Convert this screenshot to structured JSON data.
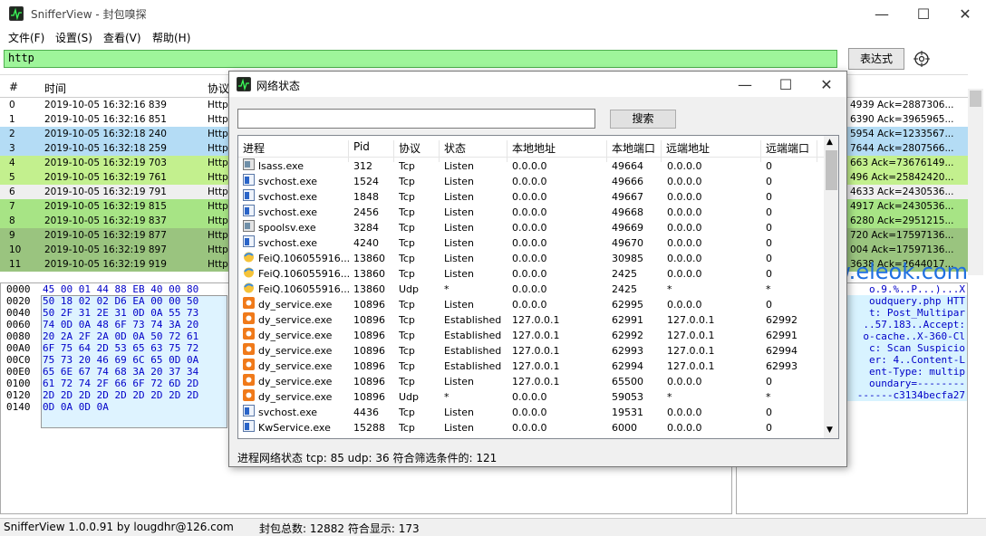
{
  "app": {
    "title": "SnifferView - 封包嗅探"
  },
  "menu": [
    "文件(F)",
    "设置(S)",
    "查看(V)",
    "帮助(H)"
  ],
  "filter": {
    "value": "http",
    "expr_button": "表达式"
  },
  "packet_table": {
    "headers": [
      "#",
      "时间",
      "协议"
    ],
    "rows": [
      {
        "n": "0",
        "time": "2019-10-05 16:32:16 839",
        "proto": "Http",
        "tail": "4939 Ack=2887306...",
        "bg": "#ffffff"
      },
      {
        "n": "1",
        "time": "2019-10-05 16:32:16 851",
        "proto": "Http",
        "tail": "6390 Ack=3965965...",
        "bg": "#ffffff"
      },
      {
        "n": "2",
        "time": "2019-10-05 16:32:18 240",
        "proto": "Http",
        "tail": "5954 Ack=1233567...",
        "bg": "#b4dcf5"
      },
      {
        "n": "3",
        "time": "2019-10-05 16:32:18 259",
        "proto": "Http",
        "tail": "7644 Ack=2807566...",
        "bg": "#b4dcf5"
      },
      {
        "n": "4",
        "time": "2019-10-05 16:32:19 703",
        "proto": "Http",
        "tail": "663 Ack=73676149...",
        "bg": "#c3f08e"
      },
      {
        "n": "5",
        "time": "2019-10-05 16:32:19 761",
        "proto": "Http",
        "tail": "496 Ack=25842420...",
        "bg": "#c3f08e"
      },
      {
        "n": "6",
        "time": "2019-10-05 16:32:19 791",
        "proto": "Http",
        "tail": "4633 Ack=2430536...",
        "bg": "#efefef"
      },
      {
        "n": "7",
        "time": "2019-10-05 16:32:19 815",
        "proto": "Http",
        "tail": "4917 Ack=2430536...",
        "bg": "#a7e485"
      },
      {
        "n": "8",
        "time": "2019-10-05 16:32:19 837",
        "proto": "Http",
        "tail": "6280 Ack=2951215...",
        "bg": "#a7e485"
      },
      {
        "n": "9",
        "time": "2019-10-05 16:32:19 877",
        "proto": "Http",
        "tail": "720 Ack=17597136...",
        "bg": "#9ac47f"
      },
      {
        "n": "10",
        "time": "2019-10-05 16:32:19 897",
        "proto": "Http",
        "tail": "004 Ack=17597136...",
        "bg": "#9ac47f"
      },
      {
        "n": "11",
        "time": "2019-10-05 16:32:19 919",
        "proto": "Http",
        "tail": "3638 Ack=2644017...",
        "bg": "#9ac47f"
      }
    ]
  },
  "hex": {
    "addresses": [
      "0000",
      "0020",
      "0040",
      "0060",
      "0080",
      "00A0",
      "00C0",
      "00E0",
      "0100",
      "0120",
      "0140"
    ],
    "rows": [
      "45 00 01 44 88 EB 40 00 80",
      "50 18 02 02 D6 EA 00 00 50",
      "50 2F 31 2E 31 0D 0A 55 73",
      "74 0D 0A 48 6F 73 74 3A 20",
      "20 2A 2F 2A 0D 0A 50 72 61",
      "6F 75 64 2D 53 65 63 75 72",
      "75 73 20 46 69 6C 65 0D 0A",
      "65 6E 67 74 68 3A 20 37 34",
      "61 72 74 2F 66 6F 72 6D 2D",
      "2D 2D 2D 2D 2D 2D 2D 2D 2D",
      "0D 0A 0D 0A"
    ]
  },
  "ascii": {
    "rows": [
      "o.9.%..P...)...X",
      "oudquery.php HTT",
      "t: Post_Multipar",
      "..57.183..Accept:",
      "o-cache..X-360-Cl",
      "c: Scan Suspicio",
      "er: 4..Content-L",
      "ent-Type: multip",
      "oundary=--------",
      "------c3134becfa27",
      ""
    ]
  },
  "watermark": "www.eleok.com",
  "status": {
    "app": "SnifferView  1.0.0.91  by  lougdhr@126.com",
    "counts": "封包总数: 12882  符合显示: 173"
  },
  "dialog": {
    "title": "网络状态",
    "search_placeholder": "",
    "search_button": "搜索",
    "headers": [
      "进程",
      "Pid",
      "协议",
      "状态",
      "本地地址",
      "本地端口",
      "远端地址",
      "远端端口"
    ],
    "rows": [
      {
        "p": "lsass.exe",
        "pid": "312",
        "pr": "Tcp",
        "st": "Listen",
        "la": "0.0.0.0",
        "lp": "49664",
        "ra": "0.0.0.0",
        "rp": "0",
        "ic": "grey"
      },
      {
        "p": "svchost.exe",
        "pid": "1524",
        "pr": "Tcp",
        "st": "Listen",
        "la": "0.0.0.0",
        "lp": "49666",
        "ra": "0.0.0.0",
        "rp": "0",
        "ic": "blue"
      },
      {
        "p": "svchost.exe",
        "pid": "1848",
        "pr": "Tcp",
        "st": "Listen",
        "la": "0.0.0.0",
        "lp": "49667",
        "ra": "0.0.0.0",
        "rp": "0",
        "ic": "blue"
      },
      {
        "p": "svchost.exe",
        "pid": "2456",
        "pr": "Tcp",
        "st": "Listen",
        "la": "0.0.0.0",
        "lp": "49668",
        "ra": "0.0.0.0",
        "rp": "0",
        "ic": "blue"
      },
      {
        "p": "spoolsv.exe",
        "pid": "3284",
        "pr": "Tcp",
        "st": "Listen",
        "la": "0.0.0.0",
        "lp": "49669",
        "ra": "0.0.0.0",
        "rp": "0",
        "ic": "grey"
      },
      {
        "p": "svchost.exe",
        "pid": "4240",
        "pr": "Tcp",
        "st": "Listen",
        "la": "0.0.0.0",
        "lp": "49670",
        "ra": "0.0.0.0",
        "rp": "0",
        "ic": "blue"
      },
      {
        "p": "FeiQ.106055916...",
        "pid": "13860",
        "pr": "Tcp",
        "st": "Listen",
        "la": "0.0.0.0",
        "lp": "30985",
        "ra": "0.0.0.0",
        "rp": "0",
        "ic": "feiq"
      },
      {
        "p": "FeiQ.106055916...",
        "pid": "13860",
        "pr": "Tcp",
        "st": "Listen",
        "la": "0.0.0.0",
        "lp": "2425",
        "ra": "0.0.0.0",
        "rp": "0",
        "ic": "feiq"
      },
      {
        "p": "FeiQ.106055916...",
        "pid": "13860",
        "pr": "Udp",
        "st": "*",
        "la": "0.0.0.0",
        "lp": "2425",
        "ra": "*",
        "rp": "*",
        "ic": "feiq"
      },
      {
        "p": "dy_service.exe",
        "pid": "10896",
        "pr": "Tcp",
        "st": "Listen",
        "la": "0.0.0.0",
        "lp": "62995",
        "ra": "0.0.0.0",
        "rp": "0",
        "ic": "dy"
      },
      {
        "p": "dy_service.exe",
        "pid": "10896",
        "pr": "Tcp",
        "st": "Established",
        "la": "127.0.0.1",
        "lp": "62991",
        "ra": "127.0.0.1",
        "rp": "62992",
        "ic": "dy"
      },
      {
        "p": "dy_service.exe",
        "pid": "10896",
        "pr": "Tcp",
        "st": "Established",
        "la": "127.0.0.1",
        "lp": "62992",
        "ra": "127.0.0.1",
        "rp": "62991",
        "ic": "dy"
      },
      {
        "p": "dy_service.exe",
        "pid": "10896",
        "pr": "Tcp",
        "st": "Established",
        "la": "127.0.0.1",
        "lp": "62993",
        "ra": "127.0.0.1",
        "rp": "62994",
        "ic": "dy"
      },
      {
        "p": "dy_service.exe",
        "pid": "10896",
        "pr": "Tcp",
        "st": "Established",
        "la": "127.0.0.1",
        "lp": "62994",
        "ra": "127.0.0.1",
        "rp": "62993",
        "ic": "dy"
      },
      {
        "p": "dy_service.exe",
        "pid": "10896",
        "pr": "Tcp",
        "st": "Listen",
        "la": "127.0.0.1",
        "lp": "65500",
        "ra": "0.0.0.0",
        "rp": "0",
        "ic": "dy"
      },
      {
        "p": "dy_service.exe",
        "pid": "10896",
        "pr": "Udp",
        "st": "*",
        "la": "0.0.0.0",
        "lp": "59053",
        "ra": "*",
        "rp": "*",
        "ic": "dy"
      },
      {
        "p": "svchost.exe",
        "pid": "4436",
        "pr": "Tcp",
        "st": "Listen",
        "la": "0.0.0.0",
        "lp": "19531",
        "ra": "0.0.0.0",
        "rp": "0",
        "ic": "blue"
      },
      {
        "p": "KwService.exe",
        "pid": "15288",
        "pr": "Tcp",
        "st": "Listen",
        "la": "0.0.0.0",
        "lp": "6000",
        "ra": "0.0.0.0",
        "rp": "0",
        "ic": "blue"
      }
    ],
    "status": "进程网络状态 tcp: 85 udp: 36  符合筛选条件的: 121"
  }
}
